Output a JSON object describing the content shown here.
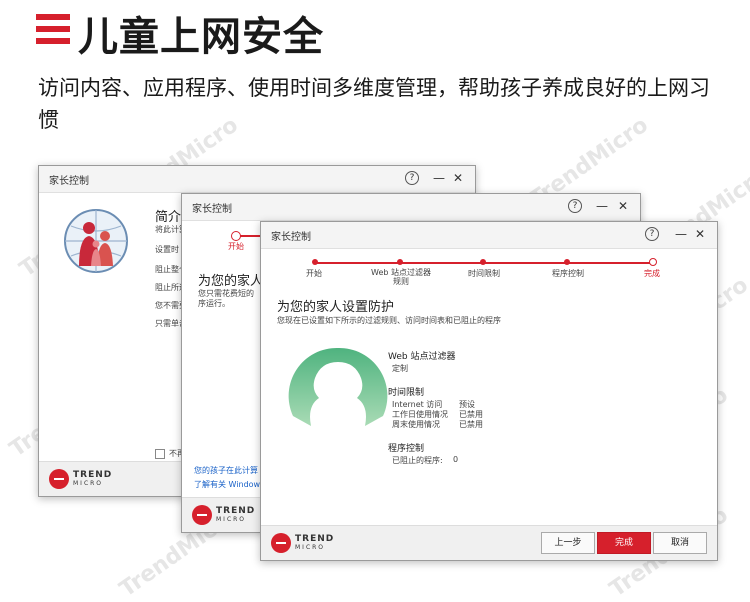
{
  "header": {
    "title": "儿童上网安全",
    "subtitle": "访问内容、应用程序、使用时间多维度管理，帮助孩子养成良好的上网习惯"
  },
  "brand": {
    "logo_main": "TREND",
    "logo_sub": "MICRO",
    "accent": "#d6202c"
  },
  "watermark": "TrendMicro",
  "win1": {
    "title": "家长控制",
    "heading": "简介",
    "lines": [
      "将此计算",
      "设置时",
      "阻止整个",
      "阻止所述",
      "您不需要",
      "只需单击"
    ],
    "checkbox_label": "不再"
  },
  "win2": {
    "title": "家长控制",
    "step_label": "开始",
    "heading": "为您的家人",
    "desc_lines": [
      "您只需花费短的",
      "序运行。"
    ],
    "link1": "您的孩子在此计算",
    "link2": "了解有关 Windows"
  },
  "win3": {
    "title": "家长控制",
    "steps": [
      "开始",
      "Web 站点过滤器\n规则",
      "时间限制",
      "程序控制",
      "完成"
    ],
    "heading": "为您的家人设置防护",
    "desc": "您现在已设置如下所示的过滤规则、访问时间表和已阻止的程序",
    "web_title": "Web 站点过滤器",
    "web_value": "定制",
    "time_title": "时间限制",
    "time_rows": [
      {
        "label": "Internet 访问",
        "value": "预设"
      },
      {
        "label": "工作日使用情况",
        "value": "已禁用"
      },
      {
        "label": "周末使用情况",
        "value": "已禁用"
      }
    ],
    "prog_title": "程序控制",
    "prog_row": {
      "label": "已阻止的程序:",
      "value": "0"
    },
    "buttons": {
      "back": "上一步",
      "finish": "完成",
      "cancel": "取消"
    }
  }
}
